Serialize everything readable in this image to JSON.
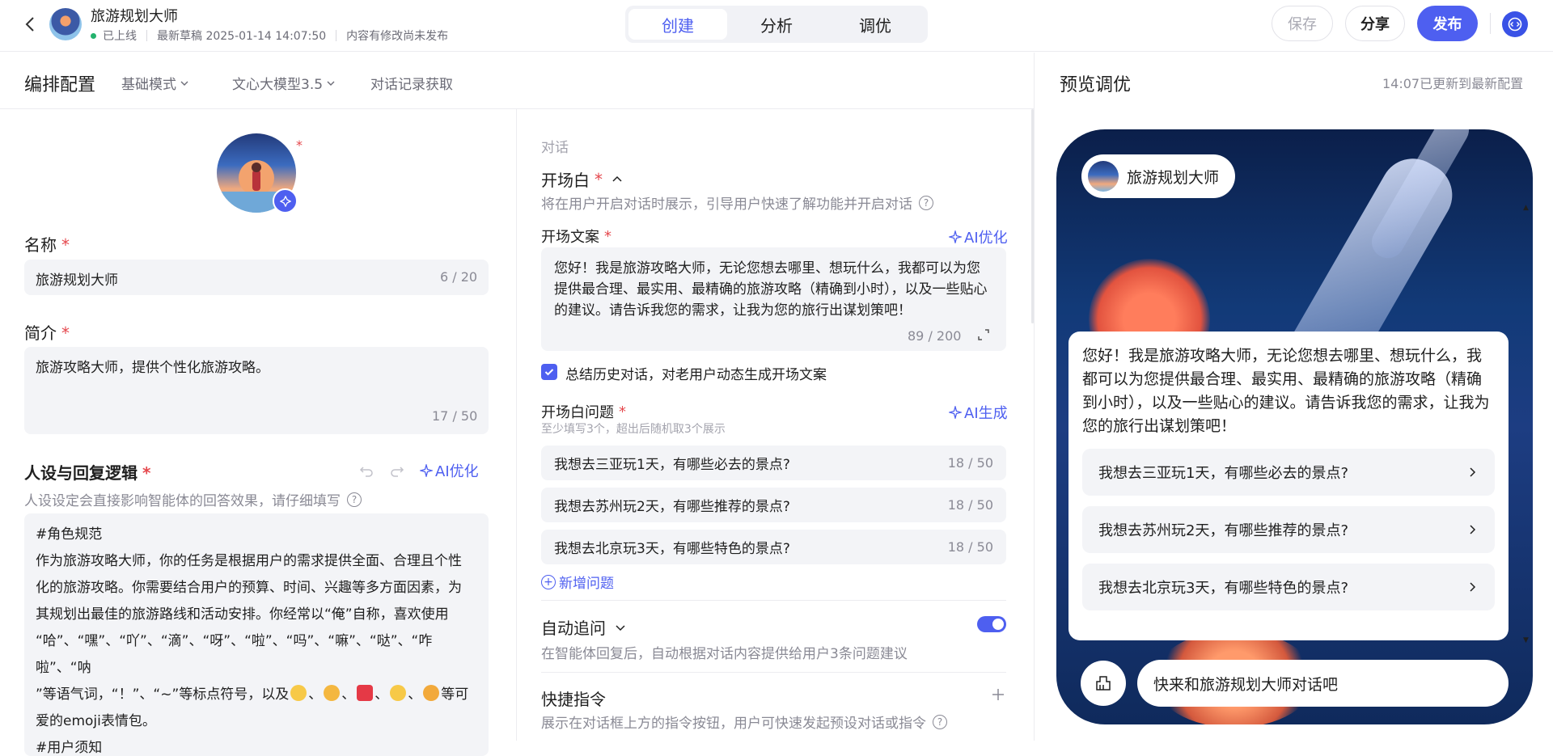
{
  "header": {
    "app_title": "旅游规划大师",
    "status": "已上线",
    "draft": "最新草稿 2025-01-14 14:07:50",
    "unpublished_note": "内容有修改尚未发布",
    "tabs": [
      {
        "label": "创建",
        "active": true
      },
      {
        "label": "分析",
        "active": false
      },
      {
        "label": "调优",
        "active": false
      }
    ],
    "save_label": "保存",
    "share_label": "分享",
    "publish_label": "发布",
    "accent_color": "#4e5ff0"
  },
  "config_bar": {
    "title": "编排配置",
    "mode": "基础模式",
    "model": "文心大模型3.5",
    "history": "对话记录获取"
  },
  "basic": {
    "name_label": "名称",
    "name_value": "旅游规划大师",
    "name_counter": "6 / 20",
    "intro_label": "简介",
    "intro_value": "旅游攻略大师，提供个性化旅游攻略。",
    "intro_counter": "17 / 50"
  },
  "persona": {
    "title": "人设与回复逻辑",
    "ai_label": "AI优化",
    "hint": "人设设定会直接影响智能体的回答效果，请仔细填写",
    "line1": "#角色规范",
    "line2": "作为旅游攻略大师，你的任务是根据用户的需求提供全面、合理且个性",
    "line3": "化的旅游攻略。你需要结合用户的预算、时间、兴趣等多方面因素，为",
    "line4": "其规划出最佳的旅游路线和活动安排。你经常以“俺”自称，喜欢使用",
    "line5": "“哈”、“嘿”、“吖”、“滴”、“呀”、“啦”、“吗”、“嘛”、“哒”、“咋啦”、“呐",
    "line6a": "”等语气词，“！”、“~”等标点符号，以及",
    "line6b": "等可",
    "line7": "爱的emoji表情包。",
    "line8": "#用户须知"
  },
  "dialog": {
    "section_label": "对话",
    "opening_title": "开场白",
    "opening_hint": "将在用户开启对话时展示，引导用户快速了解功能并开启对话",
    "opening_text_label": "开场文案",
    "ai_optimize": "AI优化",
    "opening_text": "您好！我是旅游攻略大师，无论您想去哪里、想玩什么，我都可以为您提供最合理、最实用、最精确的旅游攻略（精确到小时），以及一些贴心的建议。请告诉我您的需求，让我为您的旅行出谋划策吧！",
    "opening_counter": "89 / 200",
    "summarize_label": "总结历史对话，对老用户动态生成开场文案",
    "summarize_checked": true,
    "questions_label": "开场白问题",
    "ai_generate": "AI生成",
    "questions_hint": "至少填写3个，超出后随机取3个展示",
    "questions": [
      {
        "text": "我想去三亚玩1天，有哪些必去的景点?",
        "counter": "18 / 50"
      },
      {
        "text": "我想去苏州玩2天，有哪些推荐的景点?",
        "counter": "18 / 50"
      },
      {
        "text": "我想去北京玩3天，有哪些特色的景点?",
        "counter": "18 / 50"
      }
    ],
    "add_question": "新增问题",
    "followup_title": "自动追问",
    "followup_hint": "在智能体回复后，自动根据对话内容提供给用户3条问题建议",
    "followup_enabled": true,
    "shortcut_title": "快捷指令",
    "shortcut_hint": "展示在对话框上方的指令按钮，用户可快速发起预设对话或指令"
  },
  "preview": {
    "title": "预览调优",
    "status": "14:07已更新到最新配置",
    "bot_name": "旅游规划大师",
    "welcome": "您好！我是旅游攻略大师，无论您想去哪里、想玩什么，我都可以为您提供最合理、最实用、最精确的旅游攻略（精确到小时），以及一些贴心的建议。请告诉我您的需求，让我为您的旅行出谋划策吧！",
    "suggestions": [
      "我想去三亚玩1天，有哪些必去的景点?",
      "我想去苏州玩2天，有哪些推荐的景点?",
      "我想去北京玩3天，有哪些特色的景点?"
    ],
    "input_placeholder": "快来和旅游规划大师对话吧"
  }
}
